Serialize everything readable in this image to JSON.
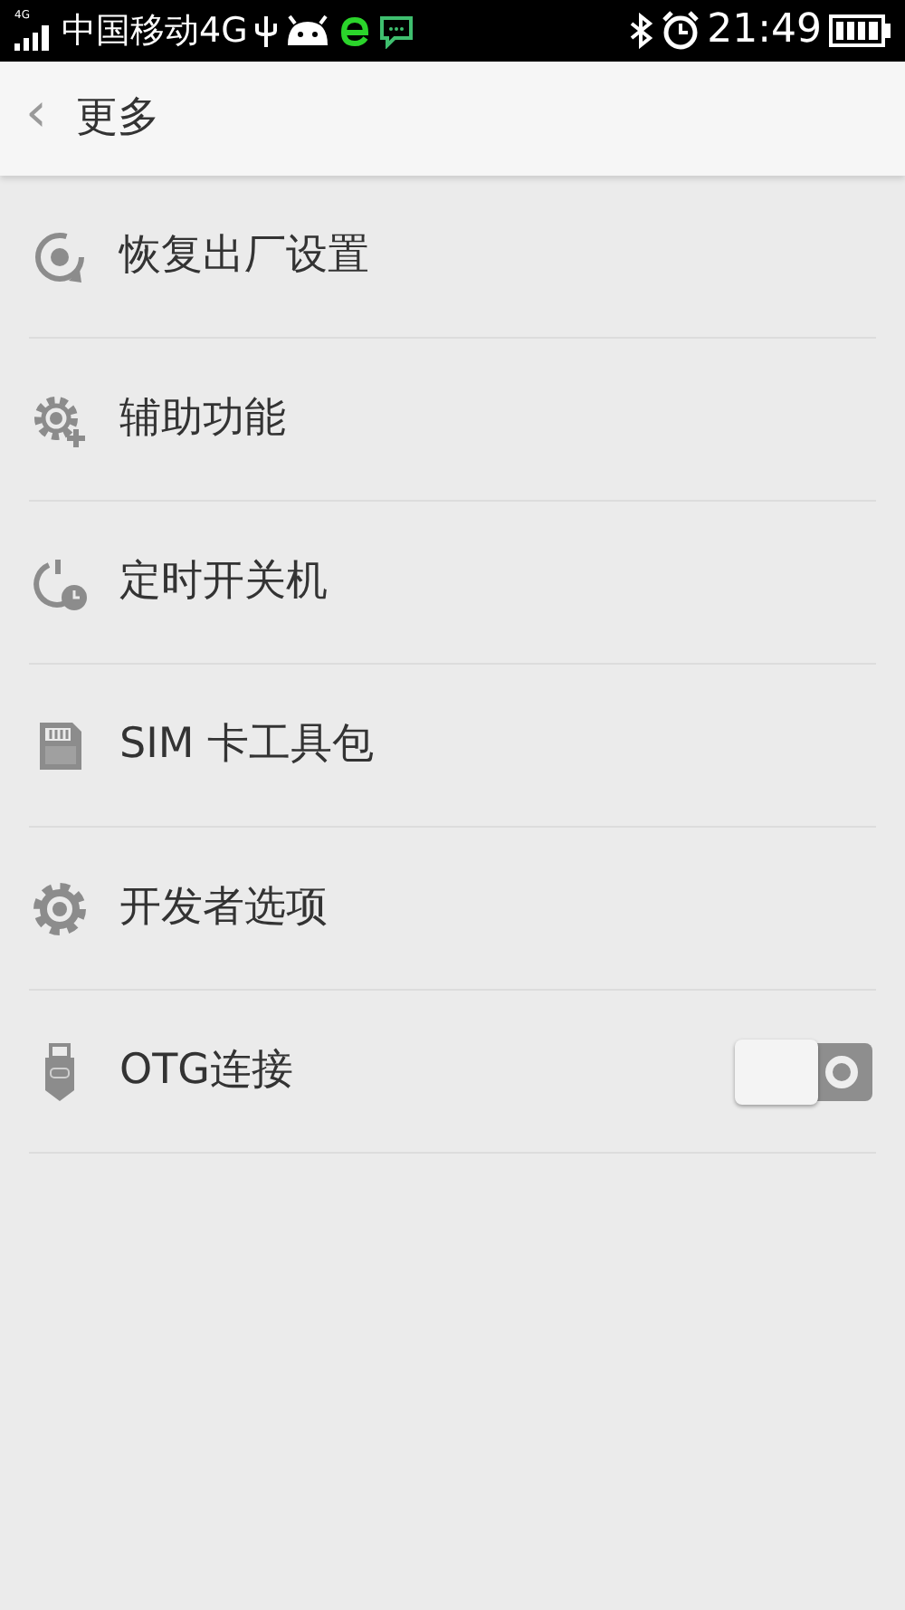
{
  "status_bar": {
    "network_type": "4G",
    "carrier": "中国移动4G",
    "time": "21:49"
  },
  "header": {
    "back": "‹",
    "title": "更多"
  },
  "items": [
    {
      "kind": "link",
      "label": "恢复出厂设置"
    },
    {
      "kind": "link",
      "label": "辅助功能"
    },
    {
      "kind": "link",
      "label": "定时开关机"
    },
    {
      "kind": "link",
      "label": "SIM 卡工具包"
    },
    {
      "kind": "link",
      "label": "开发者选项"
    },
    {
      "kind": "switch",
      "label": "OTG连接",
      "on": false
    }
  ]
}
